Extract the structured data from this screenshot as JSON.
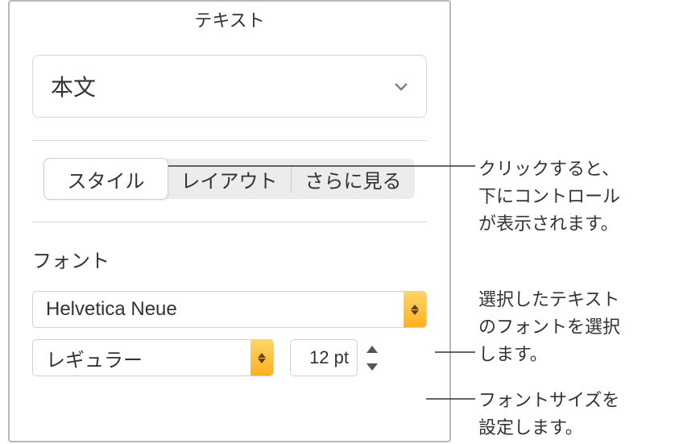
{
  "panel": {
    "title": "テキスト",
    "paragraph_style": "本文",
    "tabs": {
      "style": "スタイル",
      "layout": "レイアウト",
      "more": "さらに見る"
    },
    "font": {
      "section_label": "フォント",
      "family": "Helvetica Neue",
      "weight": "レギュラー",
      "size": "12 pt"
    }
  },
  "annotations": {
    "tabs": "クリックすると、\n下にコントロール\nが表示されます。",
    "font_family": "選択したテキスト\nのフォントを選択\nします。",
    "font_size": "フォントサイズを\n設定します。"
  }
}
